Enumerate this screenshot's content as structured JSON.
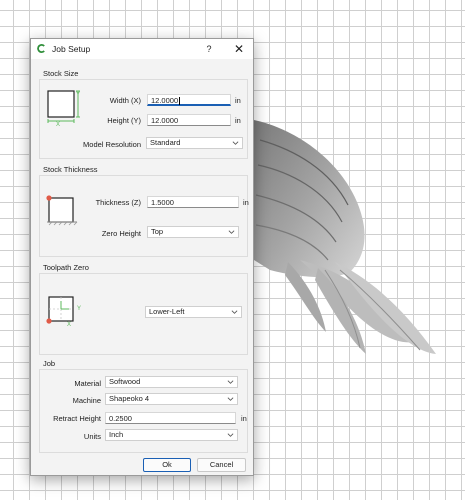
{
  "dialog": {
    "title": "Job Setup",
    "help": "?",
    "close": "✕"
  },
  "stock_size": {
    "title": "Stock Size",
    "width_label": "Width (X)",
    "width_value": "12.0000",
    "width_unit": "in",
    "height_label": "Height (Y)",
    "height_value": "12.0000",
    "height_unit": "in",
    "resolution_label": "Model Resolution",
    "resolution_value": "Standard",
    "axis_x": "X",
    "axis_y": "Y"
  },
  "stock_thickness": {
    "title": "Stock Thickness",
    "thickness_label": "Thickness (Z)",
    "thickness_value": "1.5000",
    "thickness_unit": "in",
    "zero_height_label": "Zero Height",
    "zero_height_value": "Top"
  },
  "toolpath_zero": {
    "title": "Toolpath Zero",
    "value": "Lower-Left",
    "axis_x": "X",
    "axis_y": "Y"
  },
  "job": {
    "title": "Job",
    "material_label": "Material",
    "material_value": "Softwood",
    "machine_label": "Machine",
    "machine_value": "Shapeoko 4",
    "retract_label": "Retract Height",
    "retract_value": "0.2500",
    "retract_unit": "in",
    "units_label": "Units",
    "units_value": "Inch"
  },
  "buttons": {
    "ok": "Ok",
    "cancel": "Cancel"
  },
  "colors": {
    "accent": "#1a5fb4",
    "axis_green": "#5cb85c",
    "origin_red": "#e05a47",
    "app_icon": "#2f8f3a"
  }
}
